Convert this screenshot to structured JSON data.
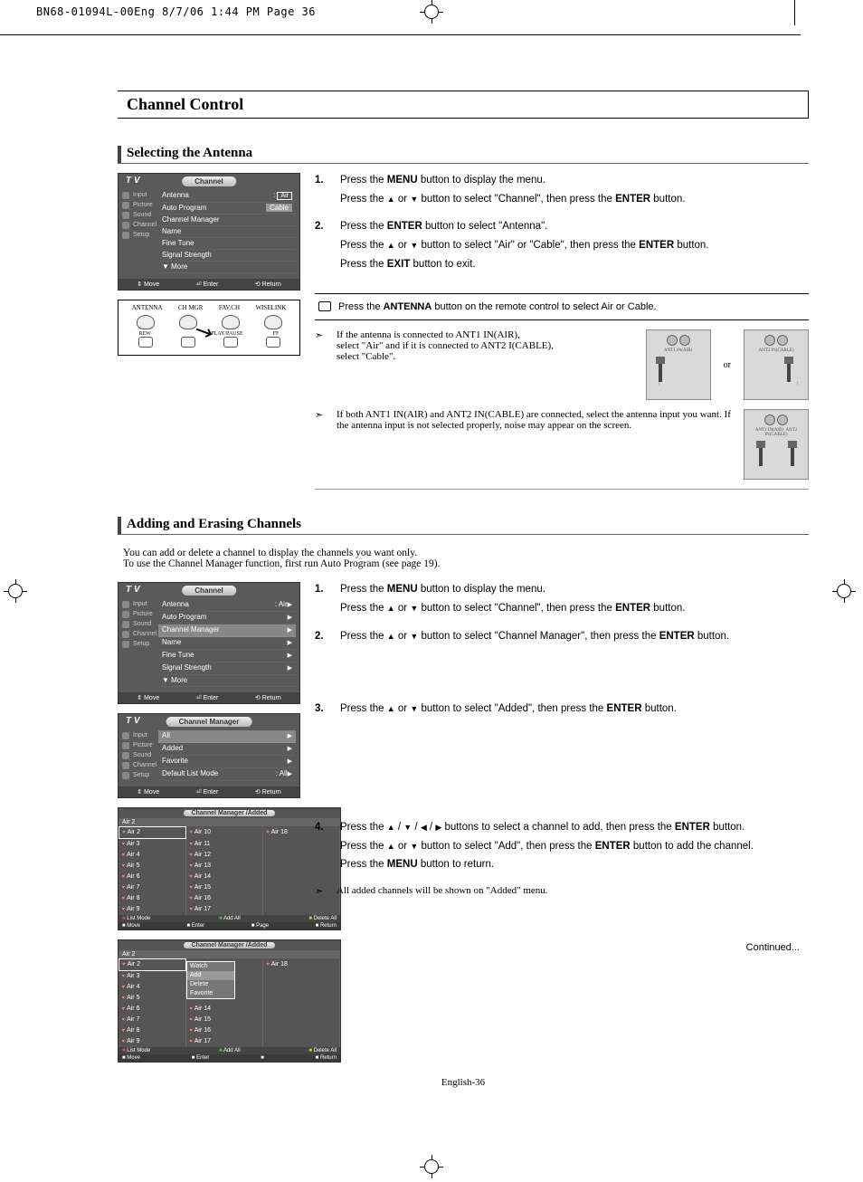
{
  "print_header": "BN68-01094L-00Eng  8/7/06  1:44 PM  Page 36",
  "section_title": "Channel Control",
  "sub1": "Selecting the Antenna",
  "osd1": {
    "tv": "T V",
    "title": "Channel",
    "side": [
      "Input",
      "Picture",
      "Sound",
      "Channel",
      "Setup"
    ],
    "items": [
      {
        "l": "Antenna",
        "r": ": Air",
        "boxed": true
      },
      {
        "l": "Auto Program",
        "r": "Cable",
        "rbg": true
      },
      {
        "l": "Channel Manager",
        "r": ""
      },
      {
        "l": "Name",
        "r": ""
      },
      {
        "l": "Fine Tune",
        "r": ""
      },
      {
        "l": "Signal Strength",
        "r": ""
      },
      {
        "l": "▼ More",
        "r": ""
      }
    ],
    "foot": [
      "Move",
      "Enter",
      "Return"
    ]
  },
  "remote": {
    "labels": [
      "ANTENNA",
      "CH MGR",
      "FAV.CH",
      "WISELINK"
    ],
    "labels2": [
      "REW",
      "",
      "PLAY/PAUSE",
      "FF"
    ]
  },
  "steps1": [
    {
      "n": "1.",
      "lines": [
        "Press the <b>MENU</b> button to display the menu.",
        "Press the <span class='glyph-up'></span> or <span class='glyph-dn'></span> button to select \"Channel\", then press the <b>ENTER</b> button."
      ]
    },
    {
      "n": "2.",
      "lines": [
        "Press the <b>ENTER</b> button to select \"Antenna\".",
        "Press the <span class='glyph-up'></span> or <span class='glyph-dn'></span> button to select \"Air\" or \"Cable\", then press the <b>ENTER</b> button.",
        "Press the <b>EXIT</b> button to exit."
      ]
    }
  ],
  "tip1": "Press the <b>ANTENNA</b> button on the remote control to select Air or Cable.",
  "note1": "If the antenna is connected to ANT1 IN(AIR),\nselect \"Air\" and if it is connected to ANT2 I(CABLE),\nselect \"Cable\".",
  "note2": "If both ANT1 IN(AIR) and ANT2 IN(CABLE) are connected, select the antenna input you want. If the antenna input is not selected properly, noise may appear on the screen.",
  "ant_labels": {
    "l": "ANT1 IN(AIR)",
    "r": "ANT2 IN(CABLE)",
    "or": "or"
  },
  "sub2": "Adding and Erasing Channels",
  "intro2": "You can add or delete a channel to display the channels you want only.\nTo use the Channel Manager function, first run Auto Program (see page 19).",
  "osd2": {
    "tv": "T V",
    "title": "Channel",
    "side": [
      "Input",
      "Picture",
      "Sound",
      "Channel",
      "Setup"
    ],
    "items": [
      {
        "l": "Antenna",
        "r": ": Air",
        "tri": true
      },
      {
        "l": "Auto Program",
        "r": "",
        "tri": true
      },
      {
        "l": "Channel Manager",
        "r": "",
        "sel": true,
        "tri": true
      },
      {
        "l": "Name",
        "r": "",
        "tri": true
      },
      {
        "l": "Fine Tune",
        "r": "",
        "tri": true
      },
      {
        "l": "Signal Strength",
        "r": "",
        "tri": true
      },
      {
        "l": "▼ More",
        "r": ""
      }
    ],
    "foot": [
      "Move",
      "Enter",
      "Return"
    ]
  },
  "osd3": {
    "tv": "T V",
    "title": "Channel Manager",
    "side": [
      "Input",
      "Picture",
      "Sound",
      "Channel",
      "Setup"
    ],
    "items": [
      {
        "l": "All",
        "r": "",
        "sel": true,
        "tri": true
      },
      {
        "l": "Added",
        "r": "",
        "tri": true
      },
      {
        "l": "Favorite",
        "r": "",
        "tri": true
      },
      {
        "l": "Default List Mode",
        "r": ": All",
        "tri": true
      }
    ],
    "foot": [
      "Move",
      "Enter",
      "Return"
    ]
  },
  "grid1": {
    "title": "Channel Manager /Added",
    "hdr": "Air 2",
    "cols": [
      [
        "Air 2",
        "Air 3",
        "Air 4",
        "Air 5",
        "Air 6",
        "Air 7",
        "Air 8",
        "Air 9"
      ],
      [
        "Air 10",
        "Air 11",
        "Air 12",
        "Air 13",
        "Air 14",
        "Air 15",
        "Air 16",
        "Air 17"
      ],
      [
        "Air 18",
        "",
        "",
        "",
        "",
        "",
        "",
        ""
      ]
    ],
    "foot2": [
      "List Mode",
      "Add All",
      "Delete All"
    ],
    "foot3": [
      "Move",
      "Enter",
      "Page",
      "Return"
    ]
  },
  "grid2": {
    "title": "Channel Manager /Added",
    "hdr": "Air 2",
    "cols": [
      [
        "Air 2",
        "Air 3",
        "Air 4",
        "Air 5",
        "Air 6",
        "Air 7",
        "Air 8",
        "Air 9"
      ],
      [
        "",
        "",
        "",
        "",
        "Air 14",
        "Air 15",
        "Air 16",
        "Air 17"
      ],
      [
        "Air 18",
        "",
        "",
        "",
        "",
        "",
        "",
        ""
      ]
    ],
    "popup": [
      "Watch",
      "Add",
      "Delete",
      "Favorite"
    ],
    "foot2": [
      "List Mode",
      "Add All",
      "Delete All"
    ],
    "foot3": [
      "Move",
      "Enter",
      "",
      "Return"
    ]
  },
  "steps2": [
    {
      "n": "1.",
      "lines": [
        "Press the <b>MENU</b> button to display the menu.",
        "Press the <span class='glyph-up'></span> or <span class='glyph-dn'></span> button to select \"Channel\", then press the <b>ENTER</b> button."
      ]
    },
    {
      "n": "2.",
      "lines": [
        "Press the <span class='glyph-up'></span> or <span class='glyph-dn'></span> button to select \"Channel Manager\", then press the <b>ENTER</b> button."
      ]
    }
  ],
  "steps3": [
    {
      "n": "3.",
      "lines": [
        "Press the <span class='glyph-up'></span> or <span class='glyph-dn'></span> button to select \"Added\", then press the <b>ENTER</b> button."
      ]
    }
  ],
  "steps4": [
    {
      "n": "4.",
      "lines": [
        "Press the <span class='glyph-up'></span> / <span class='glyph-dn'></span> / <span class='glyph-l'></span> / <span class='glyph-r'></span> buttons to select a channel to add, then press the <b>ENTER</b> button.",
        "Press the <span class='glyph-up'></span> or <span class='glyph-dn'></span> button to select \"Add\", then press the <b>ENTER</b> button to add the channel.",
        "Press the <b>MENU</b> button to return."
      ]
    }
  ],
  "note4": "All added channels will be shown on \"Added\" menu.",
  "continued": "Continued...",
  "footer": "English-36"
}
